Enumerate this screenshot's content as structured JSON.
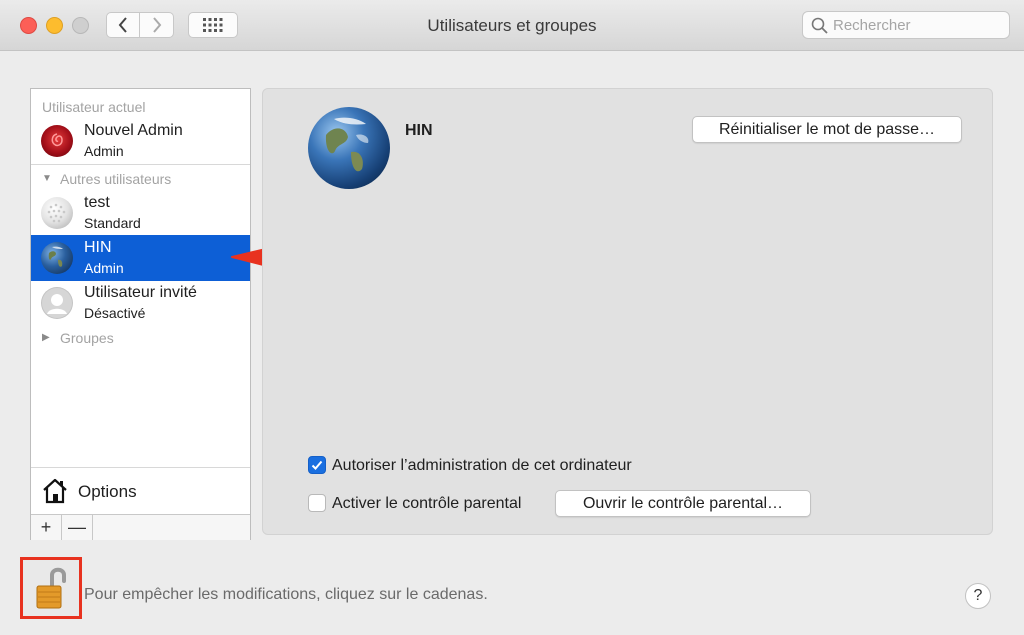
{
  "window": {
    "title": "Utilisateurs et groupes"
  },
  "search": {
    "placeholder": "Rechercher"
  },
  "sidebar": {
    "current_user_header": "Utilisateur actuel",
    "current_user": {
      "name": "Nouvel Admin",
      "role": "Admin",
      "avatar": "red-rose-avatar"
    },
    "other_users_header": "Autres utilisateurs",
    "other_users": [
      {
        "name": "test",
        "role": "Standard",
        "avatar": "golf-ball-avatar"
      },
      {
        "name": "HIN",
        "role": "Admin",
        "avatar": "earth-avatar",
        "selected": true
      },
      {
        "name": "Utilisateur invité",
        "role": "Désactivé",
        "avatar": "guest-silhouette-avatar"
      }
    ],
    "groups_header": "Groupes",
    "options_label": "Options",
    "add_label": "+",
    "remove_label": "—"
  },
  "detail": {
    "user_name": "HIN",
    "reset_password_label": "Réinitialiser le mot de passe…",
    "allow_admin_label": "Autoriser l’administration de cet ordinateur",
    "allow_admin_checked": true,
    "parental_control_label": "Activer le contrôle parental",
    "parental_control_checked": false,
    "open_parental_label": "Ouvrir le contrôle parental…"
  },
  "footer": {
    "lock_text": "Pour empêcher les modifications, cliquez sur le cadenas.",
    "lock_state": "unlocked",
    "help_label": "?"
  },
  "colors": {
    "selection": "#0d5fd6",
    "annotation": "#e8321f",
    "checkbox_on": "#1a6fe0"
  }
}
